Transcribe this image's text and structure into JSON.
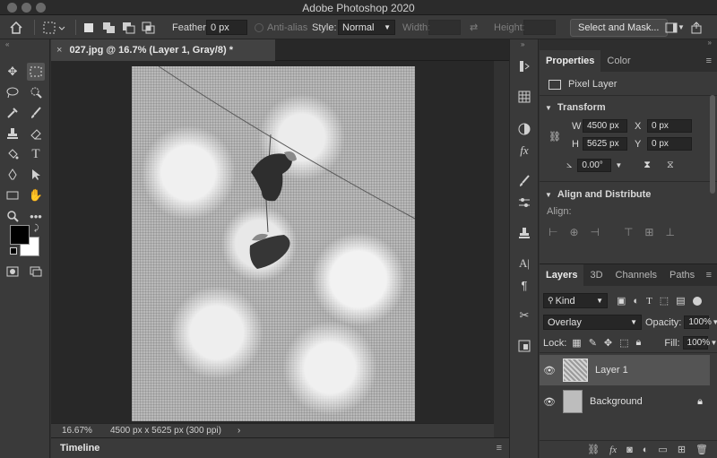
{
  "window": {
    "title": "Adobe Photoshop 2020"
  },
  "options_bar": {
    "feather_label": "Feather:",
    "feather_value": "0 px",
    "anti_alias_label": "Anti-alias",
    "style_label": "Style:",
    "style_value": "Normal",
    "width_label": "Width:",
    "height_label": "Height:",
    "select_mask_label": "Select and Mask..."
  },
  "document": {
    "tab_title": "027.jpg @ 16.7% (Layer 1, Gray/8) *",
    "zoom": "16.67%",
    "dimensions": "4500 px x 5625 px (300 ppi)"
  },
  "timeline": {
    "label": "Timeline"
  },
  "properties_panel": {
    "tabs": [
      "Properties",
      "Color"
    ],
    "layer_type": "Pixel Layer",
    "transform_label": "Transform",
    "w_label": "W",
    "w_value": "4500 px",
    "h_label": "H",
    "h_value": "5625 px",
    "x_label": "X",
    "x_value": "0 px",
    "y_label": "Y",
    "y_value": "0 px",
    "angle_value": "0.00°",
    "align_label": "Align and Distribute",
    "align_sub": "Align:"
  },
  "layers_panel": {
    "tabs": [
      "Layers",
      "3D",
      "Channels",
      "Paths"
    ],
    "filter_kind": "Kind",
    "blend_mode": "Overlay",
    "opacity_label": "Opacity:",
    "opacity_value": "100%",
    "lock_label": "Lock:",
    "fill_label": "Fill:",
    "fill_value": "100%",
    "layers": [
      {
        "name": "Layer 1"
      },
      {
        "name": "Background"
      }
    ]
  }
}
